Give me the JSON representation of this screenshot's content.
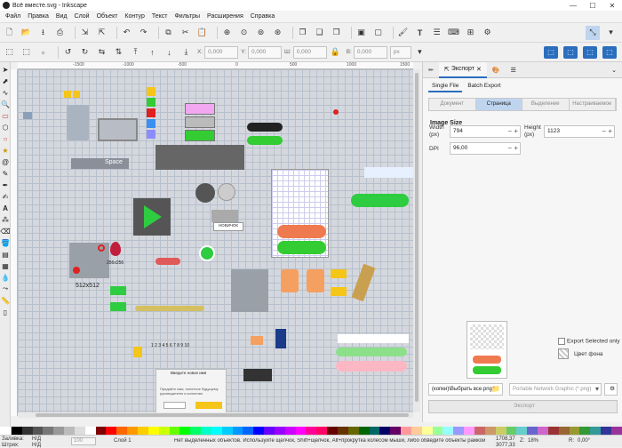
{
  "window": {
    "title": "Всё вместе.svg - Inkscape",
    "minimize": "—",
    "maximize": "☐",
    "close": "✕"
  },
  "menu": [
    "Файл",
    "Правка",
    "Вид",
    "Слой",
    "Объект",
    "Контур",
    "Текст",
    "Фильтры",
    "Расширения",
    "Справка"
  ],
  "controls": {
    "x_label": "X:",
    "x_value": "0,000",
    "y_label": "Y:",
    "y_value": "0,000",
    "w_label": "Ш:",
    "w_value": "0,000",
    "h_label": "В:",
    "h_value": "0,000",
    "unit": "px"
  },
  "ruler": {
    "ticks": [
      "-1500",
      "-1000",
      "-500",
      "0",
      "500",
      "1000",
      "1500"
    ]
  },
  "canvas_text": {
    "space": "Space",
    "size_label": "512x512",
    "small_size": "256x256",
    "dialog_title": "Введите новое имя",
    "dialog_body": "Придайте имя, понятное будущему руководителю и коллегам",
    "badge": "НОВИЧОК",
    "numbers": "1 2 3 4 5 6 7 8 9 10"
  },
  "panel": {
    "tabs": [
      "",
      "Экспорт",
      "",
      ""
    ],
    "subtabs": [
      "Single File",
      "Batch Export"
    ],
    "modes": [
      "Документ",
      "Страница",
      "Выделение",
      "Настраиваемое"
    ],
    "image_size": "Image Size",
    "width_label": "Width\n(px)",
    "width_value": "794",
    "height_label": "Height\n(px)",
    "height_value": "1123",
    "dpi_label": "DPI",
    "dpi_value": "96,00",
    "export_selected": "Export Selected only",
    "bg_color": "Цвет фона",
    "filename": "(копки)\\Выбрать все.png",
    "filetype": "Portable Network Graphic (*.png)",
    "export_button": "Экспорт"
  },
  "status": {
    "fill_label": "Заливка:",
    "fill_value": "Н/Д",
    "stroke_label": "Штрих:",
    "stroke_value": "Н/Д",
    "opacity": "100",
    "layer": "Слой 1",
    "message": "Нет выделенных объектов. Используйте щелчок, Shift+щелчок, Alt+прокрутка колесом мыши, либо обведите объекты рамкой для выделения.",
    "x": "1708,37",
    "y": "3077,33",
    "z_label": "Z:",
    "zoom": "18%",
    "r_label": "R:",
    "rotation": "0,00°"
  },
  "palette": [
    "#000000",
    "#333333",
    "#555555",
    "#777777",
    "#999999",
    "#bbbbbb",
    "#dddddd",
    "#ffffff",
    "#800000",
    "#ff0000",
    "#ff6600",
    "#ff9900",
    "#ffcc00",
    "#ffff00",
    "#ccff00",
    "#66ff00",
    "#00ff00",
    "#00ff66",
    "#00ffcc",
    "#00ffff",
    "#00ccff",
    "#0099ff",
    "#0066ff",
    "#0000ff",
    "#6600ff",
    "#9900ff",
    "#cc00ff",
    "#ff00ff",
    "#ff0099",
    "#ff0066",
    "#660000",
    "#663300",
    "#666600",
    "#006600",
    "#006666",
    "#000066",
    "#660066",
    "#ff9999",
    "#ffcc99",
    "#ffff99",
    "#99ff99",
    "#99ffff",
    "#9999ff",
    "#ff99ff",
    "#cc6666",
    "#cc9966",
    "#cccc66",
    "#66cc66",
    "#66cccc",
    "#6666cc",
    "#cc66cc",
    "#993333",
    "#996633",
    "#999933",
    "#339933",
    "#339999",
    "#333399",
    "#993399"
  ]
}
